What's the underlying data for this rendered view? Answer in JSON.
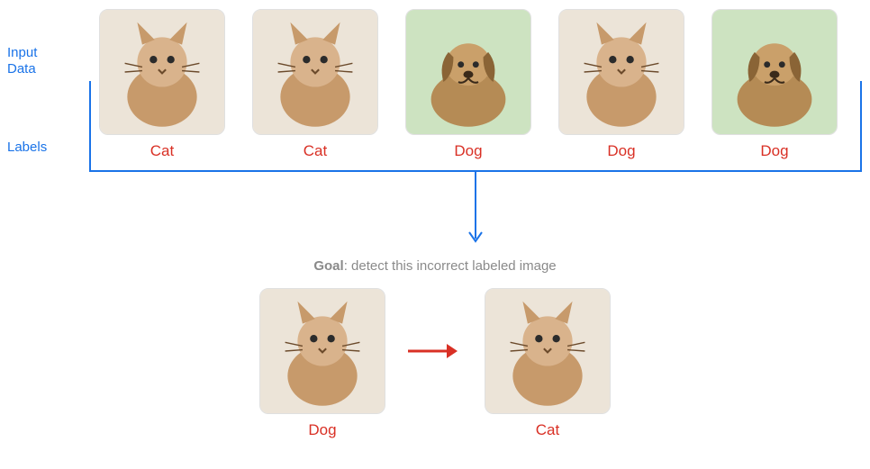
{
  "side": {
    "input_line1": "Input",
    "input_line2": "Data",
    "labels": "Labels"
  },
  "top_images": [
    {
      "name": "image-1-white-kitten",
      "label": "Cat",
      "icon": "cat"
    },
    {
      "name": "image-2-orange-cat-paw",
      "label": "Cat",
      "icon": "cat"
    },
    {
      "name": "image-3-golden-retriever",
      "label": "Dog",
      "icon": "dog"
    },
    {
      "name": "image-4-fluffy-cat",
      "label": "Dog",
      "icon": "cat"
    },
    {
      "name": "image-5-puppy-running",
      "label": "Dog",
      "icon": "dog"
    }
  ],
  "goal": {
    "prefix": "Goal",
    "text": ": detect this incorrect labeled image"
  },
  "bottom_images": [
    {
      "name": "incorrect-image",
      "label": "Dog",
      "icon": "cat"
    },
    {
      "name": "corrected-image",
      "label": "Cat",
      "icon": "cat"
    }
  ],
  "colors": {
    "blue": "#1a73e8",
    "red": "#d93025",
    "grey": "#8a8a8a"
  }
}
